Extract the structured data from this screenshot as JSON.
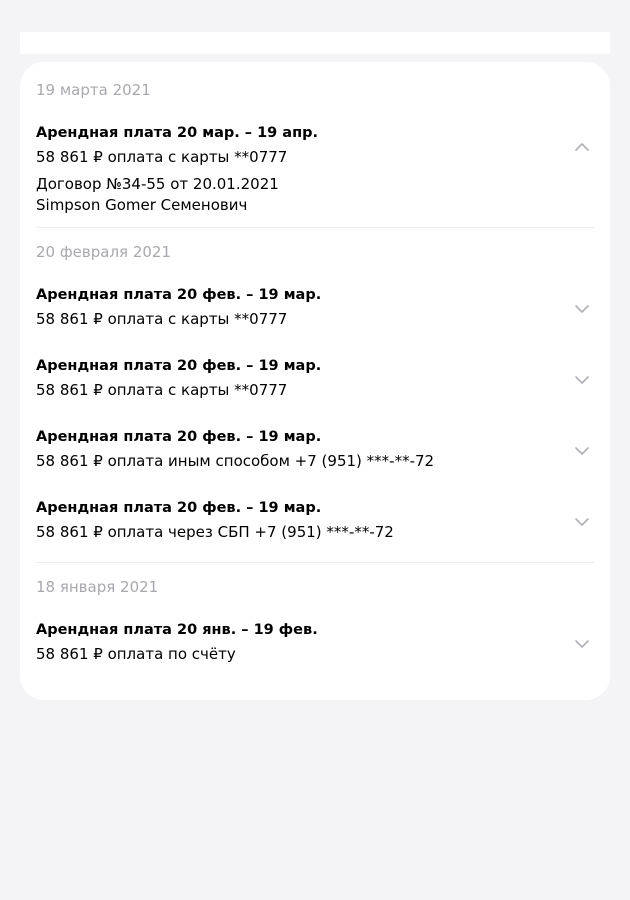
{
  "groups": [
    {
      "date": "19 марта 2021",
      "items": [
        {
          "title": "Арендная плата 20 мар. – 19 апр.",
          "subtitle": "58 861 ₽ оплата с карты **0777",
          "expanded": true,
          "details": {
            "contract": "Договор №34-55 от 20.01.2021",
            "person": "Simpson Gomer Семенович"
          }
        }
      ]
    },
    {
      "date": "20 февраля 2021",
      "items": [
        {
          "title": "Арендная плата 20 фев. – 19 мар.",
          "subtitle": "58 861 ₽ оплата с карты **0777",
          "expanded": false
        },
        {
          "title": "Арендная плата 20 фев. – 19 мар.",
          "subtitle": "58 861 ₽ оплата с карты **0777",
          "expanded": false
        },
        {
          "title": "Арендная плата 20 фев. – 19 мар.",
          "subtitle": "58 861 ₽ оплата иным способом +7 (951) ***-**-72",
          "expanded": false
        },
        {
          "title": "Арендная плата 20 фев. – 19 мар.",
          "subtitle": "58 861 ₽ оплата через СБП +7 (951) ***-**-72",
          "expanded": false
        }
      ]
    },
    {
      "date": "18 января 2021",
      "items": [
        {
          "title": "Арендная плата 20 янв. – 19 фев.",
          "subtitle": "58 861 ₽ оплата по счёту",
          "expanded": false
        }
      ]
    }
  ],
  "colors": {
    "background": "#f4f4f6",
    "card": "#ffffff",
    "date_text": "#a8a8ae",
    "chevron": "#b0b0b6",
    "divider": "#ececef"
  },
  "icons": {
    "expanded": "chevron-up-icon",
    "collapsed": "chevron-down-icon"
  }
}
